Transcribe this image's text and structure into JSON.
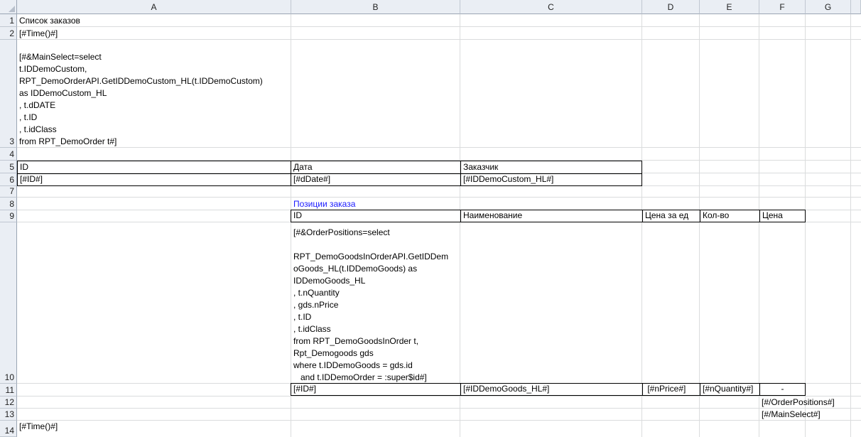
{
  "columns": [
    "A",
    "B",
    "C",
    "D",
    "E",
    "F",
    "G"
  ],
  "rows": [
    "1",
    "2",
    "3",
    "4",
    "5",
    "6",
    "7",
    "8",
    "9",
    "10",
    "11",
    "12",
    "13",
    "14"
  ],
  "cells": {
    "A1": "Список заказов",
    "A2": "[#Time()#]",
    "A3": "[#&MainSelect=select\nt.IDDemoCustom,\nRPT_DemoOrderAPI.GetIDDemoCustom_HL(t.IDDemoCustom)\nas IDDemoCustom_HL\n, t.dDATE\n, t.ID\n, t.idClass\nfrom RPT_DemoOrder t#]",
    "A5": "ID",
    "B5": "Дата",
    "C5": "Заказчик",
    "A6": "[#ID#]",
    "B6": "[#dDate#]",
    "C6": "[#IDDemoCustom_HL#]",
    "B8": "Позиции заказа",
    "B9": "ID",
    "C9": "Наименование",
    "D9": "Цена за ед",
    "E9": "Кол-во",
    "F9": "Цена",
    "B10": "[#&OrderPositions=select\n\nRPT_DemoGoodsInOrderAPI.GetIDDem\noGoods_HL(t.IDDemoGoods) as\nIDDemoGoods_HL\n, t.nQuantity\n, gds.nPrice\n, t.ID\n, t.idClass\nfrom RPT_DemoGoodsInOrder t,\nRpt_Demogoods gds\nwhere t.IDDemoGoods = gds.id\n   and t.IDDemoOrder = :super$id#]",
    "B11": "[#ID#]",
    "C11": "[#IDDemoGoods_HL#]",
    "D11": " [#nPrice#]",
    "E11": "[#nQuantity#]",
    "F11": "-",
    "F12": "[#/OrderPositions#]",
    "F13": "[#/MainSelect#]",
    "A14": "[#Time()#]"
  }
}
